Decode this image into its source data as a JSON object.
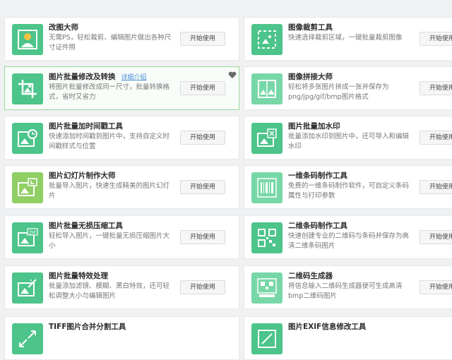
{
  "colors": {
    "icon_green": "#4cc48a",
    "icon_green_light": "#77d7a7",
    "icon_lime": "#8fcf64",
    "icon_yellow": "#f4c244",
    "highlight_border": "#9bd79a",
    "link_blue": "#4a8fd6"
  },
  "start_label": "开始使用",
  "left_tools": [
    {
      "title": "改图大师",
      "desc": "无需PS，轻松裁剪、编辑图片做出各种尺寸证件照",
      "icon": "id-photo-icon"
    },
    {
      "title": "图片批量修改及转换",
      "detail": "详细介绍",
      "desc": "将图片批量修改成同一尺寸，批量转换格式，省时又省力",
      "icon": "crop-image-icon"
    },
    {
      "title": "图片批量加时间戳工具",
      "desc": "快速添加时间戳到图片中，支持自定义时间戳样式与位置",
      "icon": "clock-image-icon"
    },
    {
      "title": "图片幻灯片制作大师",
      "desc": "批量导入图片，快速生成精美的图片幻灯片",
      "icon": "slideshow-icon"
    },
    {
      "title": "图片批量无损压缩工具",
      "desc": "轻松导入图片，一键批量无损压缩图片大小",
      "icon": "zip-image-icon"
    },
    {
      "title": "图片批量特效处理",
      "desc": "批量添加滤镜、模糊、黑白特效，还可轻松调整大小与编辑图片",
      "icon": "magic-wand-image-icon"
    },
    {
      "title": "TIFF图片合并分割工具",
      "icon": "merge-split-icon"
    }
  ],
  "right_tools": [
    {
      "title": "图像裁剪工具",
      "desc": "快速选择裁剪区域，一键批量裁剪图像",
      "icon": "crop-frame-icon"
    },
    {
      "title": "图像拼接大师",
      "desc": "轻松将多张图片拼成一张并保存为png/jpg/gif/bmp图片格式",
      "icon": "image-stitch-icon"
    },
    {
      "title": "图片批量加水印",
      "desc": "批量添加水印到图片中，还可导入和编辑水印",
      "icon": "watermark-icon"
    },
    {
      "title": "一维条码制作工具",
      "desc": "免费的一维条码制作软件，可自定义条码属性与打印参数",
      "icon": "barcode-icon"
    },
    {
      "title": "二维条码制作工具",
      "desc": "快速创建专业的二维码与条码并保存为高清二维条码图片",
      "icon": "qrcode-icon"
    },
    {
      "title": "二维码生成器",
      "desc": "将信息输入二维码生成器便可生成高清bmp二维码图片",
      "icon": "qr-generator-icon"
    },
    {
      "title": "图片EXIF信息修改工具",
      "icon": "exif-edit-icon"
    }
  ]
}
